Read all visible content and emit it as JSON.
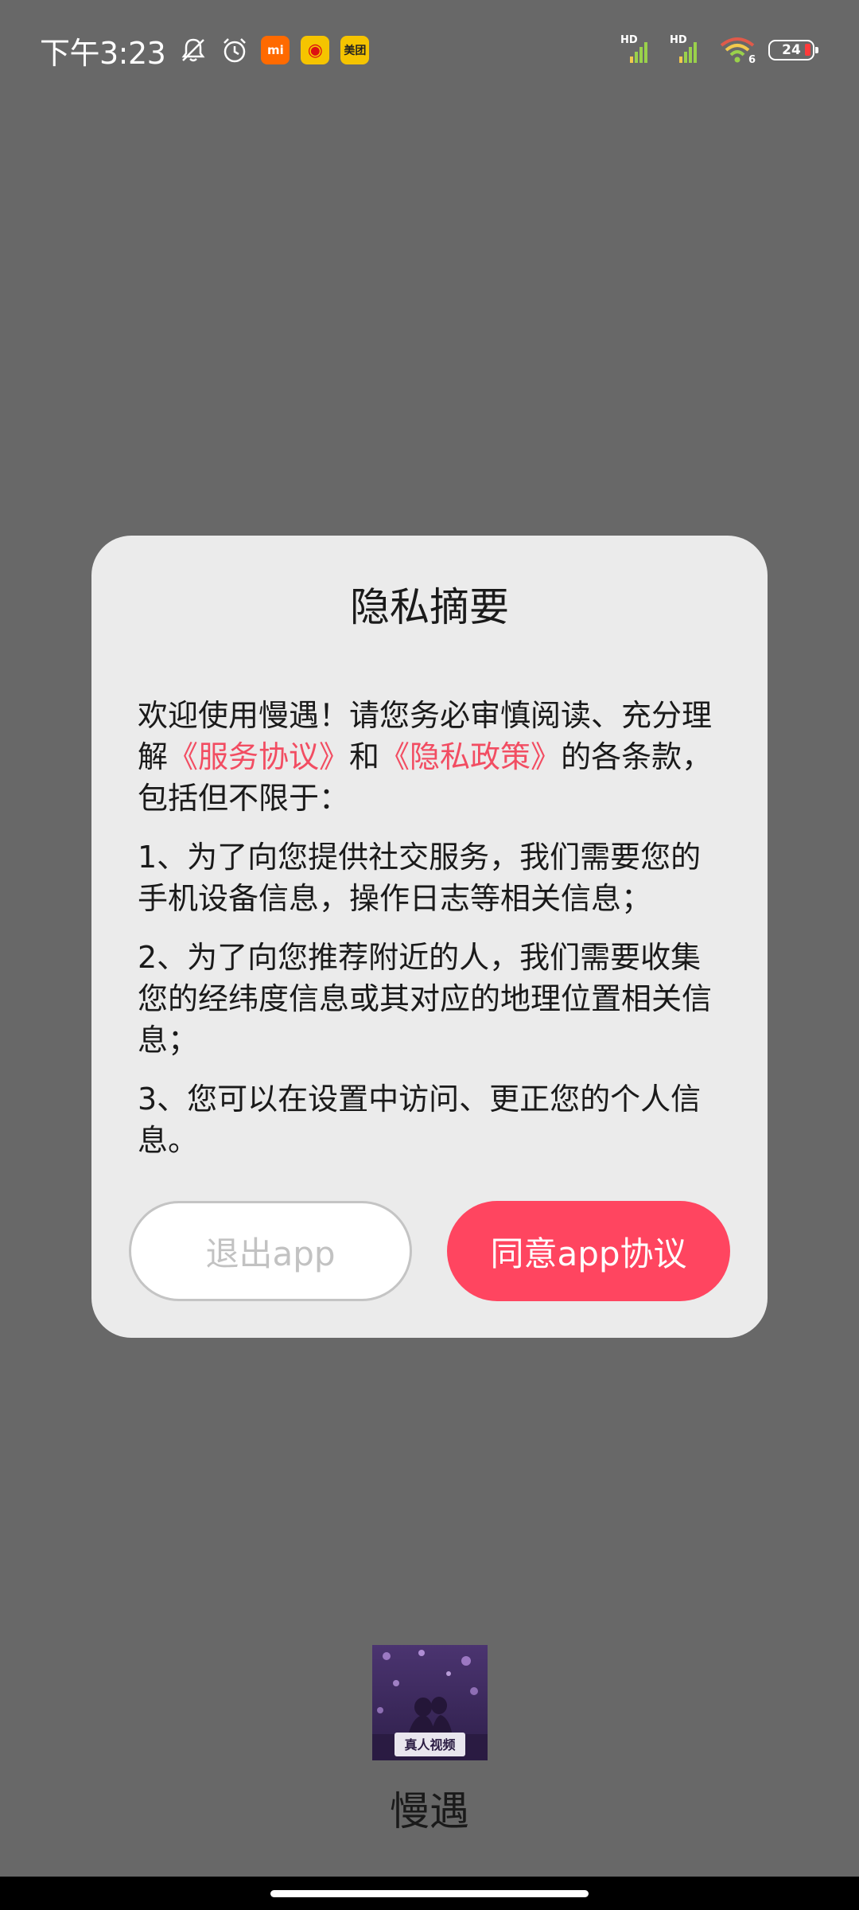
{
  "status_bar": {
    "time": "下午3:23",
    "icons": [
      "mute-icon",
      "alarm-icon"
    ],
    "apps": [
      {
        "name": "xiaomi-icon",
        "label": "mi"
      },
      {
        "name": "weibo-icon",
        "label": "◉"
      },
      {
        "name": "meituan-icon",
        "label": "美团"
      }
    ],
    "signal_label": "HD",
    "wifi_label": "6",
    "battery": "24"
  },
  "dialog": {
    "title": "隐私摘要",
    "intro_prefix": "欢迎使用慢遇！请您务必审慎阅读、充分理解",
    "service_link": "《服务协议》",
    "and_text": "和",
    "privacy_link": "《隐私政策》",
    "intro_suffix": "的各条款，包括但不限于：",
    "items": [
      "1、为了向您提供社交服务，我们需要您的手机设备信息，操作日志等相关信息；",
      "2、为了向您推荐附近的人，我们需要收集您的经纬度信息或其对应的地理位置相关信息；",
      "3、您可以在设置中访问、更正您的个人信息。"
    ],
    "exit_button": "退出app",
    "agree_button": "同意app协议"
  },
  "app": {
    "name": "慢遇",
    "logo_caption": "真人视频"
  },
  "colors": {
    "link": "#f24d62",
    "agree": "#ff4560",
    "overlay": "#686868",
    "dialog_bg": "#ebebeb"
  }
}
